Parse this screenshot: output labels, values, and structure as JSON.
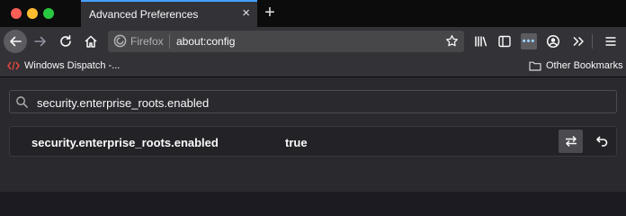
{
  "tab": {
    "title": "Advanced Preferences",
    "close_glyph": "×"
  },
  "new_tab_glyph": "+",
  "urlbar": {
    "brand": "Firefox",
    "url": "about:config"
  },
  "bookmarks": {
    "item": {
      "label": "Windows Dispatch -..."
    },
    "other": {
      "label": "Other Bookmarks"
    }
  },
  "search": {
    "value": "security.enterprise_roots.enabled"
  },
  "pref": {
    "name": "security.enterprise_roots.enabled",
    "value": "true"
  },
  "extension_glyph": "•••",
  "colors": {
    "accent": "#45a1ff",
    "toolbar": "#323237",
    "content": "#2a2a2e",
    "text": "#f9f9fa"
  }
}
